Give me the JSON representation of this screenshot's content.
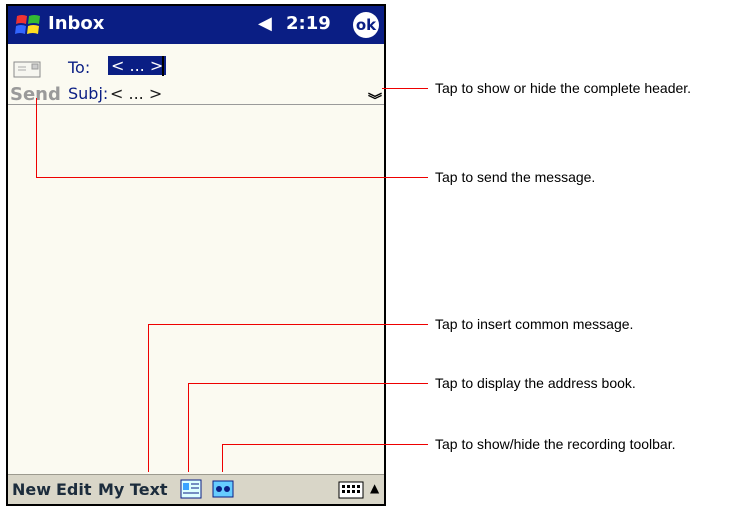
{
  "titlebar": {
    "title": "Inbox",
    "time": "2:19",
    "ok_label": "ok"
  },
  "compose": {
    "send_label": "Send",
    "to_label": "To:",
    "to_value": "< ... >",
    "subj_label": "Subj:",
    "subj_value": "< ... >"
  },
  "menubar": {
    "items": [
      "New",
      "Edit",
      "My Text"
    ]
  },
  "callouts": [
    "Tap to show or hide the complete header.",
    "Tap to send the message.",
    "Tap to insert common message.",
    "Tap to display the address book.",
    "Tap to show/hide the recording toolbar."
  ],
  "colors": {
    "titlebar": "#0a1e84",
    "callout_line": "#e00000",
    "screen_bg": "#fbfaf1",
    "menubar": "#d9d6c8"
  }
}
